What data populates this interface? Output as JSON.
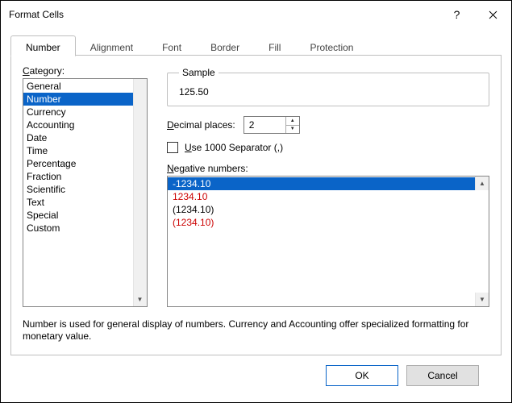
{
  "title": "Format Cells",
  "tabs": [
    {
      "label": "Number",
      "active": true
    },
    {
      "label": "Alignment"
    },
    {
      "label": "Font"
    },
    {
      "label": "Border"
    },
    {
      "label": "Fill"
    },
    {
      "label": "Protection"
    }
  ],
  "category_label": "Category:",
  "categories": [
    {
      "label": "General"
    },
    {
      "label": "Number",
      "selected": true
    },
    {
      "label": "Currency"
    },
    {
      "label": "Accounting"
    },
    {
      "label": "Date"
    },
    {
      "label": "Time"
    },
    {
      "label": "Percentage"
    },
    {
      "label": "Fraction"
    },
    {
      "label": "Scientific"
    },
    {
      "label": "Text"
    },
    {
      "label": "Special"
    },
    {
      "label": "Custom"
    }
  ],
  "sample_label": "Sample",
  "sample_value": "125.50",
  "decimal_label": "Decimal places:",
  "decimal_value": "2",
  "thousand_sep_label": "Use 1000 Separator (,)",
  "thousand_sep_checked": false,
  "negative_label": "Negative numbers:",
  "negative_formats": [
    {
      "text": "-1234.10",
      "red": false,
      "selected": true
    },
    {
      "text": "1234.10",
      "red": true
    },
    {
      "text": "(1234.10)",
      "red": false
    },
    {
      "text": "(1234.10)",
      "red": true
    }
  ],
  "description": "Number is used for general display of numbers.  Currency and Accounting offer specialized formatting for monetary value.",
  "buttons": {
    "ok": "OK",
    "cancel": "Cancel"
  }
}
